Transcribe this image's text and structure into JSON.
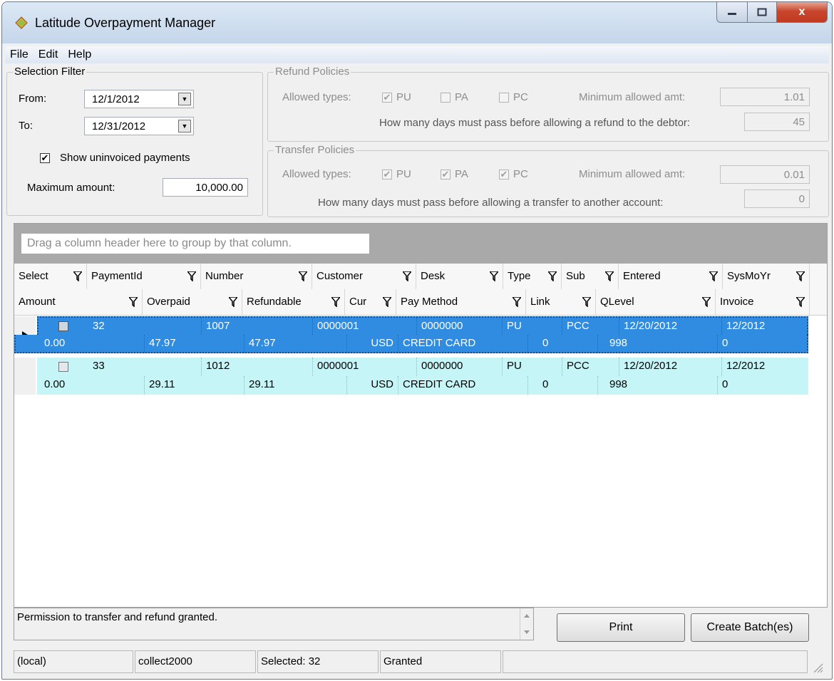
{
  "window": {
    "title": "Latitude Overpayment Manager",
    "close_glyph": "x"
  },
  "menu": [
    "File",
    "Edit",
    "Help"
  ],
  "selection_filter": {
    "title": "Selection Filter",
    "from_label": "From:",
    "from_value": "12/1/2012",
    "to_label": "To:",
    "to_value": "12/31/2012",
    "show_uninvoiced_label": "Show uninvoiced payments",
    "show_uninvoiced_checked": true,
    "max_amount_label": "Maximum amount:",
    "max_amount_value": "10,000.00"
  },
  "refund_policies": {
    "title": "Refund Policies",
    "allowed_types_label": "Allowed types:",
    "types": [
      {
        "label": "PU",
        "checked": true
      },
      {
        "label": "PA",
        "checked": false
      },
      {
        "label": "PC",
        "checked": false
      }
    ],
    "min_amt_label": "Minimum allowed amt:",
    "min_amt_value": "1.01",
    "days_label": "How many days must pass before allowing a refund to the debtor:",
    "days_value": "45"
  },
  "transfer_policies": {
    "title": "Transfer Policies",
    "allowed_types_label": "Allowed types:",
    "types": [
      {
        "label": "PU",
        "checked": true
      },
      {
        "label": "PA",
        "checked": true
      },
      {
        "label": "PC",
        "checked": true
      }
    ],
    "min_amt_label": "Minimum allowed amt:",
    "min_amt_value": "0.01",
    "days_label": "How many days must pass before allowing a transfer to another account:",
    "days_value": "0"
  },
  "grid": {
    "group_hint": "Drag a column header here to group by that column.",
    "header_row1": [
      "Select",
      "PaymentId",
      "Number",
      "Customer",
      "Desk",
      "Type",
      "Sub",
      "Entered",
      "SysMoYr"
    ],
    "header_row2": [
      "Amount",
      "Overpaid",
      "Refundable",
      "Cur",
      "Pay Method",
      "Link",
      "QLevel",
      "Invoice"
    ],
    "rows": [
      {
        "selected": true,
        "line1": [
          "32",
          "1007",
          "0000001",
          "0000000",
          "PU",
          "PCC",
          "12/20/2012",
          "12/2012"
        ],
        "line2": [
          "0.00",
          "47.97",
          "47.97",
          "USD",
          "CREDIT CARD",
          "0",
          "998",
          "0"
        ]
      },
      {
        "selected": false,
        "line1": [
          "33",
          "1012",
          "0000001",
          "0000000",
          "PU",
          "PCC",
          "12/20/2012",
          "12/2012"
        ],
        "line2": [
          "0.00",
          "29.11",
          "29.11",
          "USD",
          "CREDIT CARD",
          "0",
          "998",
          "0"
        ]
      }
    ]
  },
  "status_message": "Permission to transfer and refund granted.",
  "buttons": {
    "print": "Print",
    "create_batch": "Create Batch(es)"
  },
  "statusbar": [
    "(local)",
    "collect2000",
    "Selected: 32",
    "Granted",
    ""
  ]
}
